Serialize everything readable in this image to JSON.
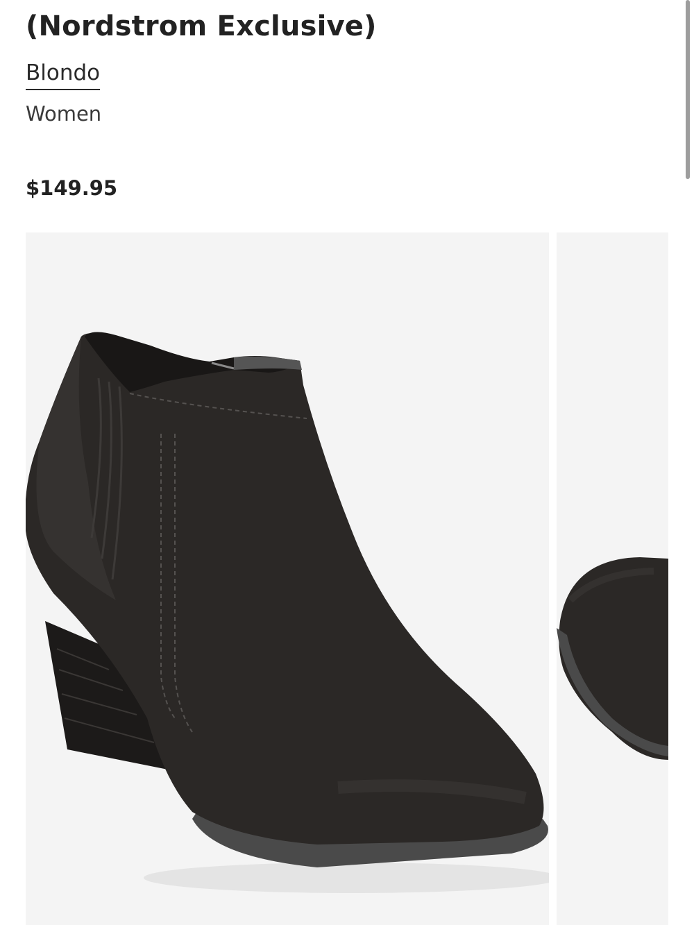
{
  "product": {
    "title": "(Nordstrom Exclusive)",
    "brand": "Blondo",
    "category": "Women",
    "price": "$149.95"
  },
  "gallery": {
    "images": [
      {
        "name": "black-ankle-bootie-side-view"
      },
      {
        "name": "black-ankle-bootie-toe-view"
      }
    ]
  },
  "colors": {
    "background": "#ffffff",
    "photo_background": "#f4f4f4",
    "boot": "#2b2826",
    "sole": "#4a4a4a"
  }
}
